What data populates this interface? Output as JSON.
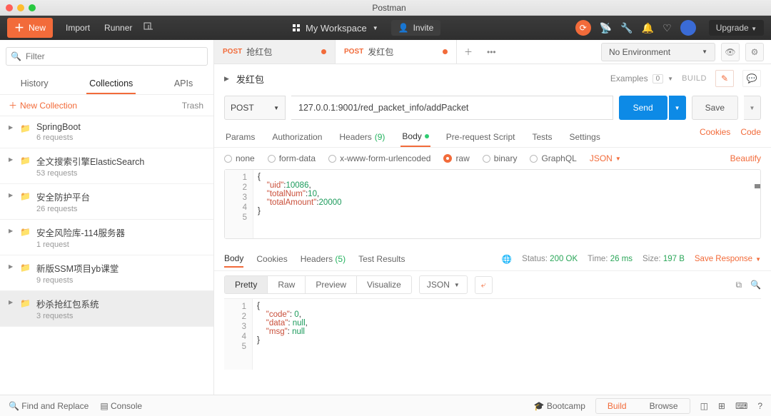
{
  "window_title": "Postman",
  "toolbar": {
    "new": "New",
    "import": "Import",
    "runner": "Runner",
    "workspace": "My Workspace",
    "invite": "Invite",
    "upgrade": "Upgrade"
  },
  "sidebar": {
    "filter_placeholder": "Filter",
    "tabs": {
      "history": "History",
      "collections": "Collections",
      "apis": "APIs"
    },
    "new_collection": "New Collection",
    "trash": "Trash",
    "items": [
      {
        "name": "SpringBoot",
        "sub": "6 requests"
      },
      {
        "name": "全文搜索引擎ElasticSearch",
        "sub": "53 requests"
      },
      {
        "name": "安全防护平台",
        "sub": "26 requests"
      },
      {
        "name": "安全风险库-114服务器",
        "sub": "1 request"
      },
      {
        "name": "新版SSM项目yb课堂",
        "sub": "9 requests"
      },
      {
        "name": "秒杀抢红包系统",
        "sub": "3 requests"
      }
    ]
  },
  "tabs": [
    {
      "method": "POST",
      "label": "抢红包"
    },
    {
      "method": "POST",
      "label": "发红包"
    }
  ],
  "env_select": "No Environment",
  "request": {
    "name": "发红包",
    "examples_label": "Examples",
    "examples_count": "0",
    "build_label": "BUILD",
    "method": "POST",
    "url": "127.0.0.1:9001/red_packet_info/addPacket",
    "send": "Send",
    "save": "Save",
    "tabs": {
      "params": "Params",
      "auth": "Authorization",
      "headers": "Headers",
      "headers_n": "(9)",
      "body": "Body",
      "prescript": "Pre-request Script",
      "tests": "Tests",
      "settings": "Settings"
    },
    "cookies": "Cookies",
    "code": "Code",
    "body_types": {
      "none": "none",
      "form": "form-data",
      "url": "x-www-form-urlencoded",
      "raw": "raw",
      "binary": "binary",
      "graphql": "GraphQL",
      "json": "JSON"
    },
    "beautify": "Beautify",
    "body_lines": [
      "{",
      "    \"uid\":10086,",
      "    \"totalNum\":10,",
      "    \"totalAmount\":20000",
      "}"
    ]
  },
  "response": {
    "tabs": {
      "body": "Body",
      "cookies": "Cookies",
      "headers": "Headers",
      "headers_n": "(5)",
      "results": "Test Results"
    },
    "status_l": "Status:",
    "status_v": "200 OK",
    "time_l": "Time:",
    "time_v": "26 ms",
    "size_l": "Size:",
    "size_v": "197 B",
    "save": "Save Response",
    "views": {
      "pretty": "Pretty",
      "raw": "Raw",
      "preview": "Preview",
      "visualize": "Visualize",
      "json": "JSON"
    },
    "body_lines": [
      "{",
      "    \"code\": 0,",
      "    \"data\": null,",
      "    \"msg\": null",
      "}"
    ]
  },
  "statusbar": {
    "find": "Find and Replace",
    "console": "Console",
    "bootcamp": "Bootcamp",
    "build": "Build",
    "browse": "Browse"
  }
}
